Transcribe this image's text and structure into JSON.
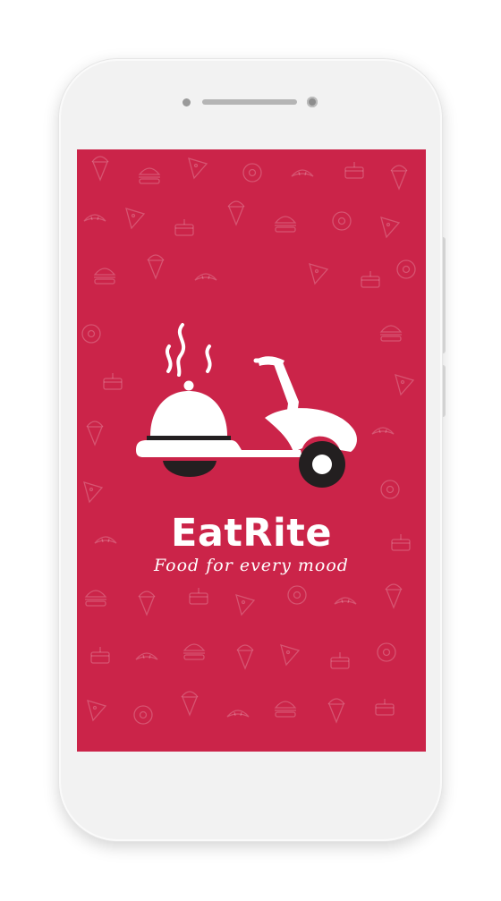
{
  "app": {
    "brand_name": "EatRite",
    "tagline": "Food for every mood"
  },
  "colors": {
    "splash_background": "#cb2449",
    "logo_dark": "#231f20",
    "logo_light": "#ffffff",
    "device_frame": "#f2f2f2"
  },
  "icons": {
    "logo": "food-delivery-scooter-with-cloche-icon",
    "background_pattern": "doodle-food-pattern"
  }
}
